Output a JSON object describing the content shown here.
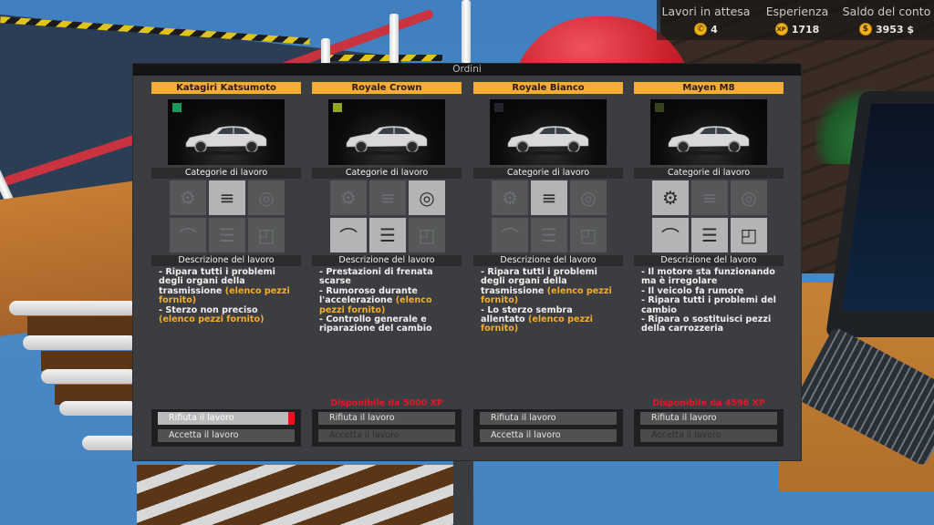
{
  "hud": {
    "pending_jobs": {
      "label": "Lavori in attesa",
      "icon": "phone-icon",
      "value": "4"
    },
    "experience": {
      "label": "Esperienza",
      "icon": "xp-icon",
      "icon_text": "XP",
      "value": "1718"
    },
    "balance": {
      "label": "Saldo del conto",
      "icon": "dollar-icon",
      "icon_text": "$",
      "value": "3953 $"
    }
  },
  "panel": {
    "title": "Ordini",
    "categories_label": "Categorie di lavoro",
    "description_label": "Descrizione del lavoro",
    "reject_label": "Rifiuta il lavoro",
    "accept_label": "Accetta il lavoro"
  },
  "orders": [
    {
      "car": "Katagiri Katsumoto",
      "swatch_color": "#1a9a5a",
      "categories": [
        {
          "icon": "engine-icon",
          "active": false
        },
        {
          "icon": "suspension-icon",
          "active": true
        },
        {
          "icon": "brakes-icon",
          "active": false
        },
        {
          "icon": "exhaust-icon",
          "active": false
        },
        {
          "icon": "gearbox-icon",
          "active": false
        },
        {
          "icon": "bodywork-icon",
          "active": false
        }
      ],
      "description": [
        {
          "text": "- Ripara tutti i problemi degli organi della trasmissione ",
          "highlight": "(elenco pezzi fornito)"
        },
        {
          "text": "- Sterzo non preciso ",
          "highlight": "(elenco pezzi fornito)"
        }
      ],
      "requirement": "",
      "reject_state": "hover",
      "accept_enabled": true
    },
    {
      "car": "Royale Crown",
      "swatch_color": "#8fa61e",
      "categories": [
        {
          "icon": "engine-icon",
          "active": false
        },
        {
          "icon": "suspension-icon",
          "active": false
        },
        {
          "icon": "brakes-icon",
          "active": true
        },
        {
          "icon": "exhaust-icon",
          "active": true
        },
        {
          "icon": "gearbox-icon",
          "active": true
        },
        {
          "icon": "bodywork-icon",
          "active": false
        }
      ],
      "description": [
        {
          "text": "- Prestazioni di frenata scarse",
          "highlight": ""
        },
        {
          "text": "- Rumoroso durante l'accelerazione ",
          "highlight": "(elenco pezzi fornito)"
        },
        {
          "text": "- Controllo generale e riparazione del cambio",
          "highlight": ""
        }
      ],
      "requirement": "Disponibile da 5000 XP",
      "reject_state": "normal",
      "accept_enabled": false
    },
    {
      "car": "Royale Bianco",
      "swatch_color": "#22232b",
      "categories": [
        {
          "icon": "engine-icon",
          "active": false
        },
        {
          "icon": "suspension-icon",
          "active": true
        },
        {
          "icon": "brakes-icon",
          "active": false
        },
        {
          "icon": "exhaust-icon",
          "active": false
        },
        {
          "icon": "gearbox-icon",
          "active": false
        },
        {
          "icon": "bodywork-icon",
          "active": false
        }
      ],
      "description": [
        {
          "text": "- Ripara tutti i problemi degli organi della trasmissione ",
          "highlight": "(elenco pezzi fornito)"
        },
        {
          "text": "- Lo sterzo sembra allentato ",
          "highlight": "(elenco pezzi fornito)"
        }
      ],
      "requirement": "",
      "reject_state": "normal",
      "accept_enabled": true
    },
    {
      "car": "Mayen M8",
      "swatch_color": "#37421a",
      "categories": [
        {
          "icon": "engine-icon",
          "active": true
        },
        {
          "icon": "suspension-icon",
          "active": false
        },
        {
          "icon": "brakes-icon",
          "active": false
        },
        {
          "icon": "exhaust-icon",
          "active": true
        },
        {
          "icon": "gearbox-icon",
          "active": true
        },
        {
          "icon": "bodywork-icon",
          "active": true
        }
      ],
      "description": [
        {
          "text": "- Il motore sta funzionando ma è irregolare",
          "highlight": ""
        },
        {
          "text": "- Il veicolo fa rumore",
          "highlight": ""
        },
        {
          "text": "- Ripara tutti i problemi del cambio",
          "highlight": ""
        },
        {
          "text": "- Ripara o sostituisci pezzi della carrozzeria",
          "highlight": ""
        }
      ],
      "requirement": "Disponibile da 4596 XP",
      "reject_state": "normal",
      "accept_enabled": false
    }
  ]
}
